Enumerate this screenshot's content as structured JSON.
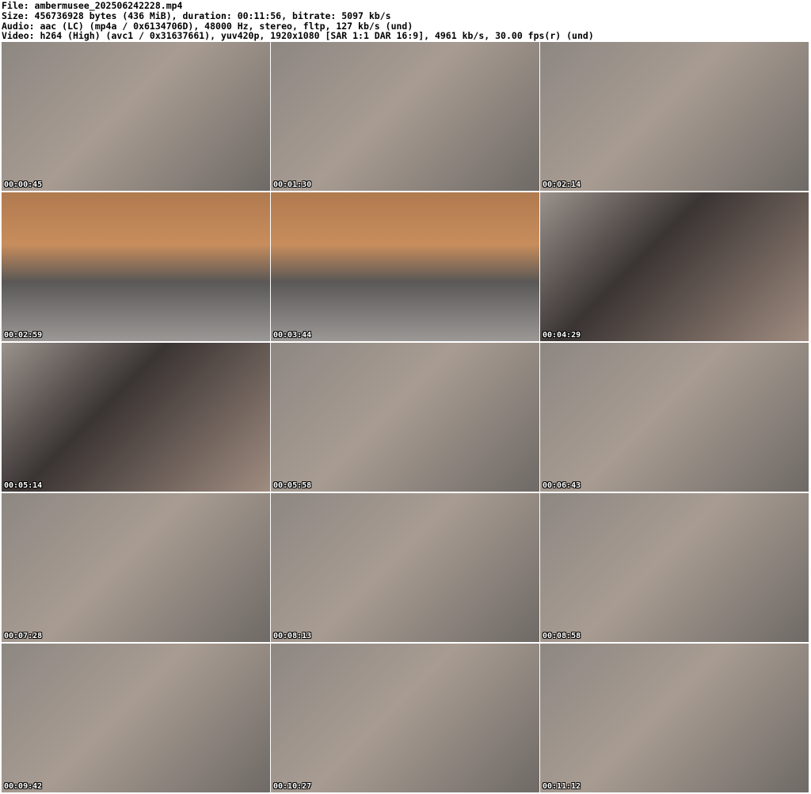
{
  "header": {
    "file": "File: ambermusee_202506242228.mp4",
    "size": "Size: 456736928 bytes (436 MiB), duration: 00:11:56, bitrate: 5097 kb/s",
    "audio": "Audio: aac (LC) (mp4a / 0x6134706D), 48000 Hz, stereo, fltp, 127 kb/s (und)",
    "video": "Video: h264 (High) (avc1 / 0x31637661), yuv420p, 1920x1080 [SAR 1:1 DAR 16:9], 4961 kb/s, 30.00 fps(r) (und)"
  },
  "thumbnails": [
    {
      "time": "00:00:45"
    },
    {
      "time": "00:01:30"
    },
    {
      "time": "00:02:14"
    },
    {
      "time": "00:02:59"
    },
    {
      "time": "00:03:44"
    },
    {
      "time": "00:04:29"
    },
    {
      "time": "00:05:14"
    },
    {
      "time": "00:05:58"
    },
    {
      "time": "00:06:43"
    },
    {
      "time": "00:07:28"
    },
    {
      "time": "00:08:13"
    },
    {
      "time": "00:08:58"
    },
    {
      "time": "00:09:42"
    },
    {
      "time": "00:10:27"
    },
    {
      "time": "00:11:12"
    }
  ]
}
